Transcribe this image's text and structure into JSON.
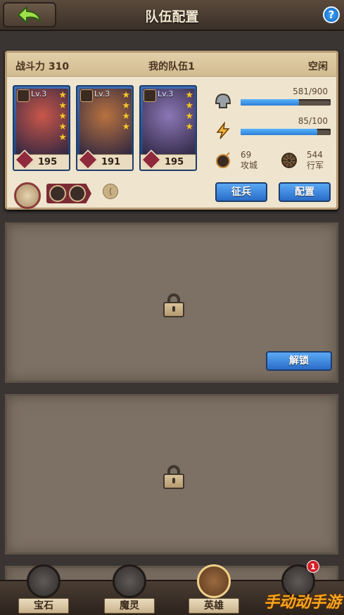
{
  "header": {
    "title": "队伍配置",
    "help_label": "?"
  },
  "team": {
    "power_label": "战斗力 310",
    "name": "我的队伍1",
    "status": "空闲",
    "heroes": [
      {
        "level": "Lv.3",
        "stars": 5,
        "power": "195",
        "role_color": "#8e2a3b",
        "portrait_color": "#c9574a"
      },
      {
        "level": "Lv.3",
        "stars": 4,
        "power": "191",
        "role_color": "#8e2a3b",
        "portrait_color": "#b8723f"
      },
      {
        "level": "Lv.3",
        "stars": 4,
        "power": "195",
        "role_color": "#8e2a3b",
        "portrait_color": "#8c77b5"
      }
    ],
    "stats": {
      "hp_text": "581/900",
      "hp_fraction": 0.645,
      "energy_text": "85/100",
      "energy_fraction": 0.85,
      "siege_value": "69",
      "siege_label": "攻城",
      "march_value": "544",
      "march_label": "行军"
    },
    "buttons": {
      "recruit": "征兵",
      "configure": "配置"
    }
  },
  "locked_slot_1": {
    "unlock_label": "解锁"
  },
  "bottom_nav": {
    "items": [
      {
        "label": "宝石",
        "icon": "gem-icon"
      },
      {
        "label": "魔灵",
        "icon": "spirit-icon"
      },
      {
        "label": "英雄",
        "icon": "hero-book-icon"
      },
      {
        "label": "",
        "icon": "relic-icon",
        "badge": "1"
      }
    ]
  },
  "watermark": "手动动手游",
  "colors": {
    "accent_blue": "#2a6cc8",
    "panel_bg": "#efe4cd",
    "badge_red": "#d3202a"
  }
}
